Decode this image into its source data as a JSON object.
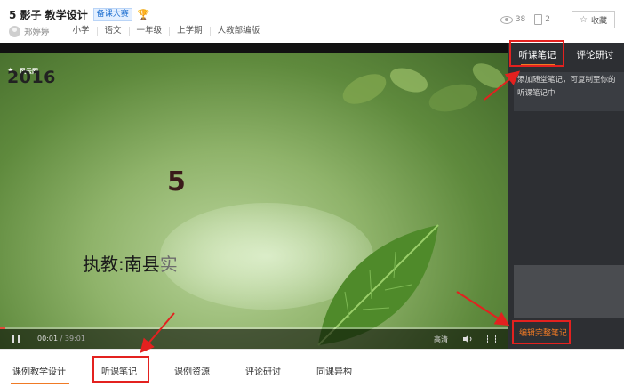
{
  "header": {
    "title": "5 影子 教学设计",
    "badge": "备课大赛",
    "author": "郑婷婷",
    "tags": [
      "小学",
      "语文",
      "一年级",
      "上学期",
      "人教部编版"
    ],
    "views": "38",
    "docs": "2",
    "collect_label": "收藏"
  },
  "video": {
    "logo": "风云网",
    "year": "2016",
    "number": "5",
    "teacher_main": "执教:南县",
    "teacher_fade": "实",
    "time_current": "00:01",
    "time_total": "/ 39:01",
    "quality": "高清",
    "progress": 0.01
  },
  "panel": {
    "tabs": [
      "听课笔记",
      "评论研讨"
    ],
    "active_tab": 0,
    "note_hint": "添加随堂笔记，可复制至你的听课笔记中",
    "edit_full": "编辑完整笔记"
  },
  "bottom_tabs": [
    "课例教学设计",
    "听课笔记",
    "课例资源",
    "评论研讨",
    "同课异构"
  ],
  "colors": {
    "accent": "#f07a25",
    "annotation_red": "#e3211f",
    "panel_bg": "#2d2f33"
  }
}
